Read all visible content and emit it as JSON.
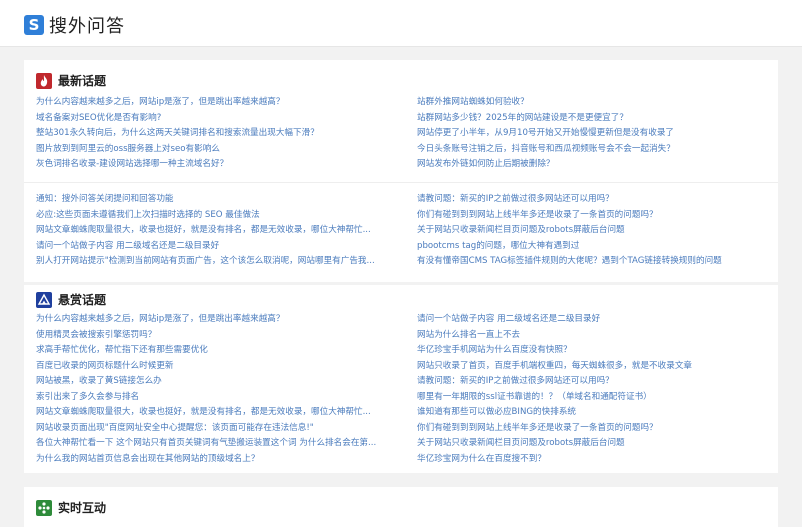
{
  "site": {
    "logo_letter": "S",
    "name": "搜外问答"
  },
  "sections": {
    "latest": {
      "title": "最新话题",
      "left": [
        "为什么内容越来越多之后，网站ip是涨了，但是跳出率越来越高？",
        "域名备案对SEO优化是否有影响?",
        "整站301永久转向后，为什么这两天关键词排名和搜索流量出现大幅下滑？",
        "图片放到到阿里云的oss服务器上对seo有影响么",
        "灰色词排名收录-建设网站选择哪一种主流域名好？"
      ],
      "right": [
        "站群外推网站蜘蛛如何验收？",
        "站群网站多少钱？2025年的网站建设是不是更便宜了？",
        "网站停更了小半年，从9月10号开始又开始慢慢更新但是没有收录了",
        "今日头条账号注销之后，抖音账号和西瓜视频账号会不会一起消失？",
        "网站发布外链如何防止后期被删除？"
      ],
      "left2": [
        "通知：搜外问答关闭提问和回答功能",
        "必应:这些页面未遵循我们上次扫描时选择的 SEO 最佳做法",
        "网站文章蜘蛛爬取量很大，收录也挺好，就是没有排名，都是无效收录，哪位大神帮忙...",
        "请问一个站做子内容 用二级域名还是二级目录好",
        "别人打开网站提示\"检测到当前网站有页面广告，这个该怎么取消呢，网站哪里有广告我..."
      ],
      "right2": [
        "请教问题：新买的IP之前做过很多网站还可以用吗？",
        "你们有碰到到到网站上线半年多还是收录了一条首页的问题吗？",
        "关于网站只收录新闻栏目页问题及robots屏蔽后台问题",
        "pbootcms tag的问题，哪位大神有遇到过",
        "有没有懂帝国CMS TAG标签插件规则的大佬呢？遇到个TAG链接转换规则的问题"
      ]
    },
    "bounty": {
      "title": "悬赏话题",
      "left": [
        "为什么内容越来越多之后，网站ip是涨了，但是跳出率越来越高？",
        "使用精灵会被搜索引擎惩罚吗？",
        "求高手帮忙优化，帮忙指下还有那些需要优化",
        "百度已收录的网页标题什么时候更新",
        "网站被黑，收录了黄S链接怎么办",
        "索引出来了多久会参与排名",
        "网站文章蜘蛛爬取量很大，收录也挺好，就是没有排名，都是无效收录，哪位大神帮忙...",
        "网站收录页面出现\"百度网址安全中心提醒您：该页面可能存在违法信息!\"",
        "各位大神帮忙看一下 这个网站只有首页关键词有气垫搬运装置这个词 为什么排名会在第...",
        "为什么我的网站首页信息会出现在其他网站的顶级域名上？"
      ],
      "right": [
        "请问一个站做子内容 用二级域名还是二级目录好",
        "网站为什么排名一直上不去",
        "华亿珍宝手机网站为什么百度没有快照？",
        "网站只收录了首页，百度手机端权重四，每天蜘蛛很多，就是不收录文章",
        "请教问题：新买的IP之前做过很多网站还可以用吗？",
        "哪里有一年期限的ssl证书靠谱的！？（单域名和通配符证书）",
        "谁知道有那些可以做必应BING的快排系统",
        "你们有碰到到到网站上线半年多还是收录了一条首页的问题吗？",
        "关于网站只收录新闻栏目页问题及robots屏蔽后台问题",
        "华亿珍宝网为什么在百度搜不到？"
      ]
    },
    "live": {
      "title": "实时互动"
    }
  },
  "colors": {
    "brand": "#2f7fd8",
    "link": "#4a7bbd",
    "latest_icon": "#c0282d",
    "bounty_icon": "#1f3f9e",
    "live_icon": "#2e8b3a"
  },
  "icons": {
    "latest": "flame-icon",
    "bounty": "mountain-icon",
    "live": "cross-dots-icon"
  }
}
